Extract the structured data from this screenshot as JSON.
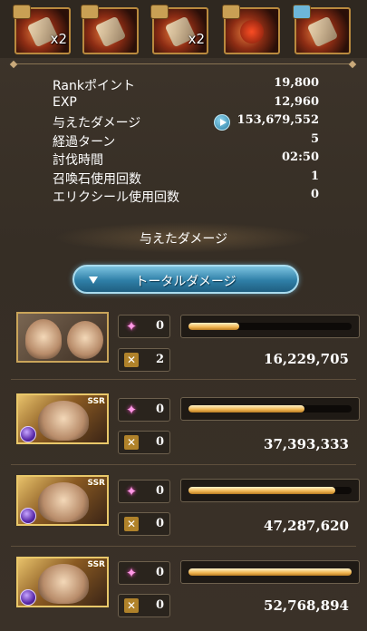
{
  "loot": [
    {
      "icon": "key-item-icon",
      "qty": "x2"
    },
    {
      "icon": "ore-item-icon",
      "qty": ""
    },
    {
      "icon": "scroll-item-icon",
      "qty": "x2"
    },
    {
      "icon": "red-crystal-icon",
      "qty": ""
    },
    {
      "icon": "key-item-icon",
      "qty": ""
    }
  ],
  "stats": [
    {
      "label": "Rankポイント",
      "value": "19,800"
    },
    {
      "label": "EXP",
      "value": "12,960"
    },
    {
      "label": "与えたダメージ",
      "value": "153,679,552"
    },
    {
      "label": "経過ターン",
      "value": "5"
    },
    {
      "label": "討伐時間",
      "value": "02:50"
    },
    {
      "label": "召喚石使用回数",
      "value": "1"
    },
    {
      "label": "エリクシール使用回数",
      "value": "0"
    }
  ],
  "damage_section": {
    "title": "与えたダメージ",
    "total_button": "トータルダメージ"
  },
  "characters": [
    {
      "name": "character-1",
      "rarity": "",
      "ougi_count": "0",
      "chain_count": "2",
      "damage": "16,229,705",
      "share": 0.31
    },
    {
      "name": "character-2",
      "rarity": "SSR",
      "ougi_count": "0",
      "chain_count": "0",
      "damage": "37,393,333",
      "share": 0.71
    },
    {
      "name": "character-3",
      "rarity": "SSR",
      "ougi_count": "0",
      "chain_count": "0",
      "damage": "47,287,620",
      "share": 0.9
    },
    {
      "name": "character-4",
      "rarity": "SSR",
      "ougi_count": "0",
      "chain_count": "0",
      "damage": "52,768,894",
      "share": 1.0
    }
  ],
  "colors": {
    "bar_fill": "#f0b551",
    "button": "#2f7fa7",
    "background": "#3a3229"
  }
}
